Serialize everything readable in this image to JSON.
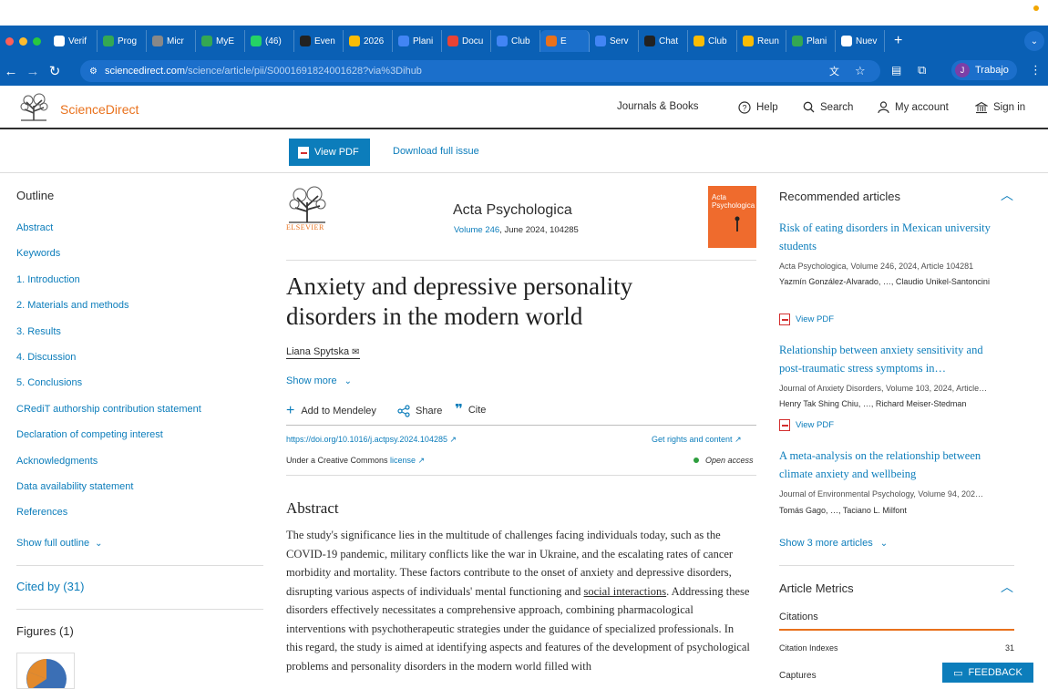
{
  "browser": {
    "tabs": [
      {
        "label": "Verif",
        "color": "#ffffff"
      },
      {
        "label": "Prog",
        "color": "#34a853"
      },
      {
        "label": "Micr",
        "color": "#888888"
      },
      {
        "label": "MyE",
        "color": "#34a853"
      },
      {
        "label": "(46)",
        "color": "#25d366"
      },
      {
        "label": "Even",
        "color": "#222222"
      },
      {
        "label": "2026",
        "color": "#fbbc04"
      },
      {
        "label": "Plani",
        "color": "#4285f4"
      },
      {
        "label": "Docu",
        "color": "#ea4335"
      },
      {
        "label": "Club",
        "color": "#4285f4"
      },
      {
        "label": "E",
        "color": "#e9711c"
      },
      {
        "label": "Serv",
        "color": "#4285f4"
      },
      {
        "label": "Chat",
        "color": "#222222"
      },
      {
        "label": "Club",
        "color": "#fbbc04"
      },
      {
        "label": "Reun",
        "color": "#fbbc04"
      },
      {
        "label": "Plani",
        "color": "#34a853"
      },
      {
        "label": "Nuev",
        "color": "#ffffff"
      }
    ],
    "url_domain": "sciencedirect.com",
    "url_rest": "/science/article/pii/S0001691824001628?via%3Dihub",
    "profile_initial": "J",
    "profile_name": "Trabajo"
  },
  "site": {
    "logo": "ScienceDirect",
    "nav": {
      "journals": "Journals & Books",
      "help": "Help",
      "search": "Search",
      "account": "My account",
      "signin": "Sign in"
    },
    "view_pdf": "View PDF",
    "download_issue": "Download full issue"
  },
  "outline": {
    "title": "Outline",
    "items": [
      "Abstract",
      "Keywords",
      "1. Introduction",
      "2. Materials and methods",
      "3. Results",
      "4. Discussion",
      "5. Conclusions",
      "CRediT authorship contribution statement",
      "Declaration of competing interest",
      "Acknowledgments",
      "Data availability statement",
      "References"
    ],
    "show_full": "Show full outline",
    "cited_by": "Cited by (31)",
    "figures": "Figures (1)"
  },
  "article": {
    "publisher": "ELSEVIER",
    "journal": "Acta Psychologica",
    "volume_link": "Volume 246",
    "volume_rest": ", June 2024, 104285",
    "cover_title": "Acta Psychologica",
    "title": "Anxiety and depressive personality disorders in the modern world",
    "author": "Liana Spytska",
    "show_more": "Show more",
    "add_mendeley": "Add to Mendeley",
    "share": "Share",
    "cite": "Cite",
    "doi": "https://doi.org/10.1016/j.actpsy.2024.104285",
    "rights": "Get rights and content",
    "license_prefix": "Under a Creative Commons ",
    "license_link": "license",
    "open_access": "Open access",
    "abstract_heading": "Abstract",
    "abstract_p1": "The study's significance lies in the multitude of challenges facing individuals today, such as the COVID-19 pandemic, military conflicts like the war in Ukraine, and the escalating rates of cancer morbidity and mortality. These factors contribute to the onset of anxiety and depressive disorders, disrupting various aspects of individuals' mental functioning and ",
    "abstract_link": "social interactions",
    "abstract_p2": ". Addressing these disorders effectively necessitates a comprehensive approach, combining pharmacological interventions with psychotherapeutic strategies under the guidance of specialized professionals. In this regard, the study is aimed at identifying aspects and features of the development of psychological problems and personality disorders in the modern world filled with"
  },
  "recommended": {
    "title": "Recommended articles",
    "items": [
      {
        "title": "Risk of eating disorders in Mexican university students",
        "meta": "Acta Psychologica, Volume 246, 2024, Article 104281",
        "authors": "Yazmín González-Alvarado, …, Claudio Unikel-Santoncini",
        "pdf": "View PDF"
      },
      {
        "title": "Relationship between anxiety sensitivity and post-traumatic stress symptoms in…",
        "meta": "Journal of Anxiety Disorders, Volume 103, 2024, Article…",
        "authors": "Henry Tak Shing Chiu, …, Richard Meiser-Stedman",
        "pdf": "View PDF"
      },
      {
        "title": "A meta-analysis on the relationship between climate anxiety and wellbeing",
        "meta": "Journal of Environmental Psychology, Volume 94, 202…",
        "authors": "Tomás Gago, …, Taciano L. Milfont"
      }
    ],
    "show_more": "Show 3 more articles"
  },
  "metrics": {
    "title": "Article Metrics",
    "citations_label": "Citations",
    "citation_indexes_label": "Citation Indexes",
    "citation_indexes_value": "31",
    "captures_label": "Captures"
  },
  "feedback": "FEEDBACK"
}
